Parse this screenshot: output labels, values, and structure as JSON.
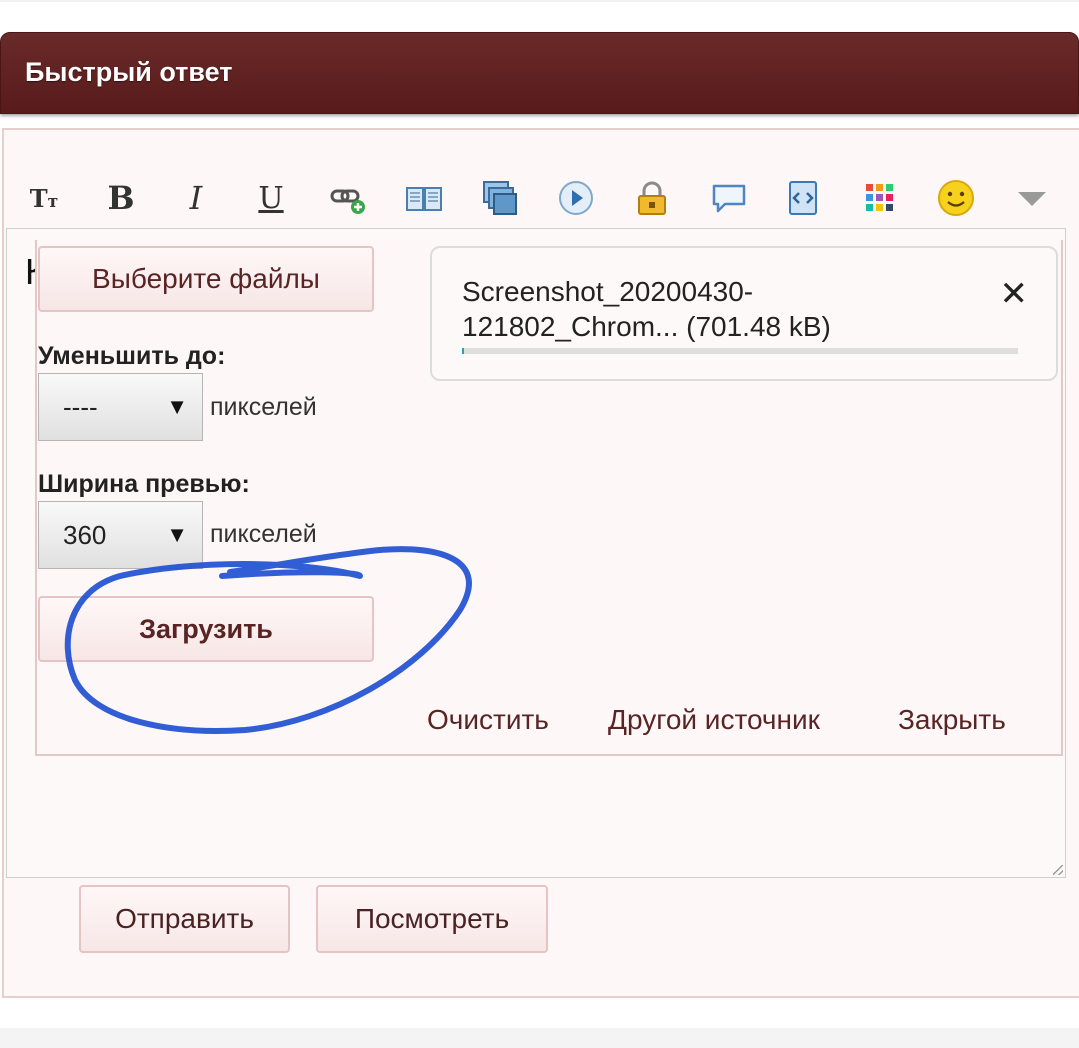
{
  "header": {
    "title": "Быстрый ответ"
  },
  "toolbar": {
    "buttons": [
      {
        "name": "font-size-icon",
        "glyph": "Tт"
      },
      {
        "name": "bold-icon",
        "glyph": "B"
      },
      {
        "name": "italic-icon",
        "glyph": "I"
      },
      {
        "name": "underline-icon",
        "glyph": "U"
      },
      {
        "name": "link-icon"
      },
      {
        "name": "book-icon"
      },
      {
        "name": "image-gallery-icon"
      },
      {
        "name": "play-video-icon"
      },
      {
        "name": "lock-icon"
      },
      {
        "name": "speech-bubble-icon"
      },
      {
        "name": "code-icon"
      },
      {
        "name": "color-grid-icon"
      },
      {
        "name": "smiley-icon"
      },
      {
        "name": "more-chevron-down-icon"
      }
    ]
  },
  "editor": {
    "visible_text": "К"
  },
  "upload": {
    "choose_files_label": "Выберите файлы",
    "reduce_label": "Уменьшить до:",
    "reduce_value": "----",
    "preview_width_label": "Ширина превью:",
    "preview_width_value": "360",
    "pixels_unit": "пикселей",
    "upload_button_label": "Загрузить",
    "file": {
      "name_line1": "Screenshot_20200430-",
      "name_line2": "121802_Chrom... (701.48 kB)",
      "progress": 0.0,
      "close_glyph": "✕"
    },
    "links": {
      "clear": "Очистить",
      "other_source": "Другой источник",
      "close": "Закрыть"
    }
  },
  "actions": {
    "send_label": "Отправить",
    "preview_label": "Посмотреть"
  },
  "colors": {
    "header_bg": "#5e1f1f",
    "button_text": "#5a2424",
    "annotation_ink": "#1f4fd1"
  }
}
